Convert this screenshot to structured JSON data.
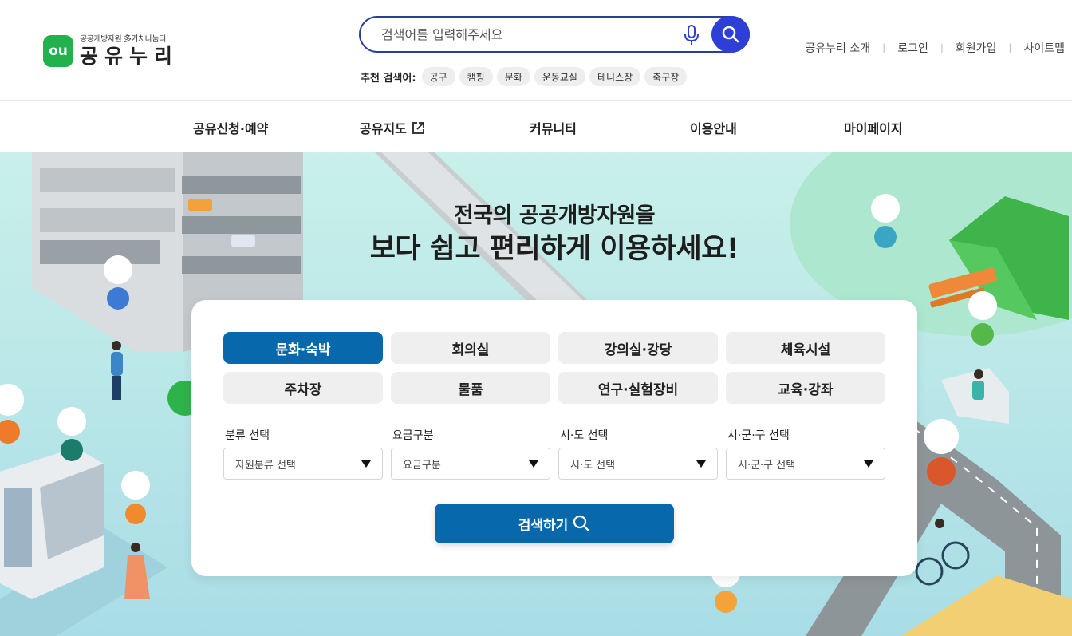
{
  "logo": {
    "mark": "ou",
    "subtitle": "공공개방자원 多가치나눔터",
    "title": "공유누리"
  },
  "search": {
    "placeholder": "검색어를 입력해주세요",
    "mic_icon": "mic-icon",
    "search_icon": "search-icon"
  },
  "recommended": {
    "label": "추천 검색어:",
    "tags": [
      "공구",
      "캠핑",
      "문화",
      "운동교실",
      "테니스장",
      "축구장"
    ]
  },
  "util_links": [
    "공유누리 소개",
    "로그인",
    "회원가입",
    "사이트맵"
  ],
  "nav": [
    "공유신청·예약",
    "공유지도",
    "커뮤니티",
    "이용안내",
    "마이페이지"
  ],
  "hero": {
    "line1": "전국의 공공개방자원을",
    "line2": "보다 쉽고 편리하게 이용하세요!"
  },
  "categories": [
    {
      "label": "문화·숙박",
      "active": true
    },
    {
      "label": "회의실",
      "active": false
    },
    {
      "label": "강의실·강당",
      "active": false
    },
    {
      "label": "체육시설",
      "active": false
    },
    {
      "label": "주차장",
      "active": false
    },
    {
      "label": "물품",
      "active": false
    },
    {
      "label": "연구·실험장비",
      "active": false
    },
    {
      "label": "교육·강좌",
      "active": false
    }
  ],
  "filters": [
    {
      "label": "분류 선택",
      "value": "자원분류 선택"
    },
    {
      "label": "요금구분",
      "value": "요금구분"
    },
    {
      "label": "시·도 선택",
      "value": "시·도 선택"
    },
    {
      "label": "시·군·구 선택",
      "value": "시·군·구 선택"
    }
  ],
  "search_button": "검색하기",
  "colors": {
    "primary": "#0768ac",
    "search_border": "#2c3d9c",
    "search_button": "#2e3fd8",
    "logo_green": "#22b14c",
    "hero_bg": "#bfe9e3"
  }
}
